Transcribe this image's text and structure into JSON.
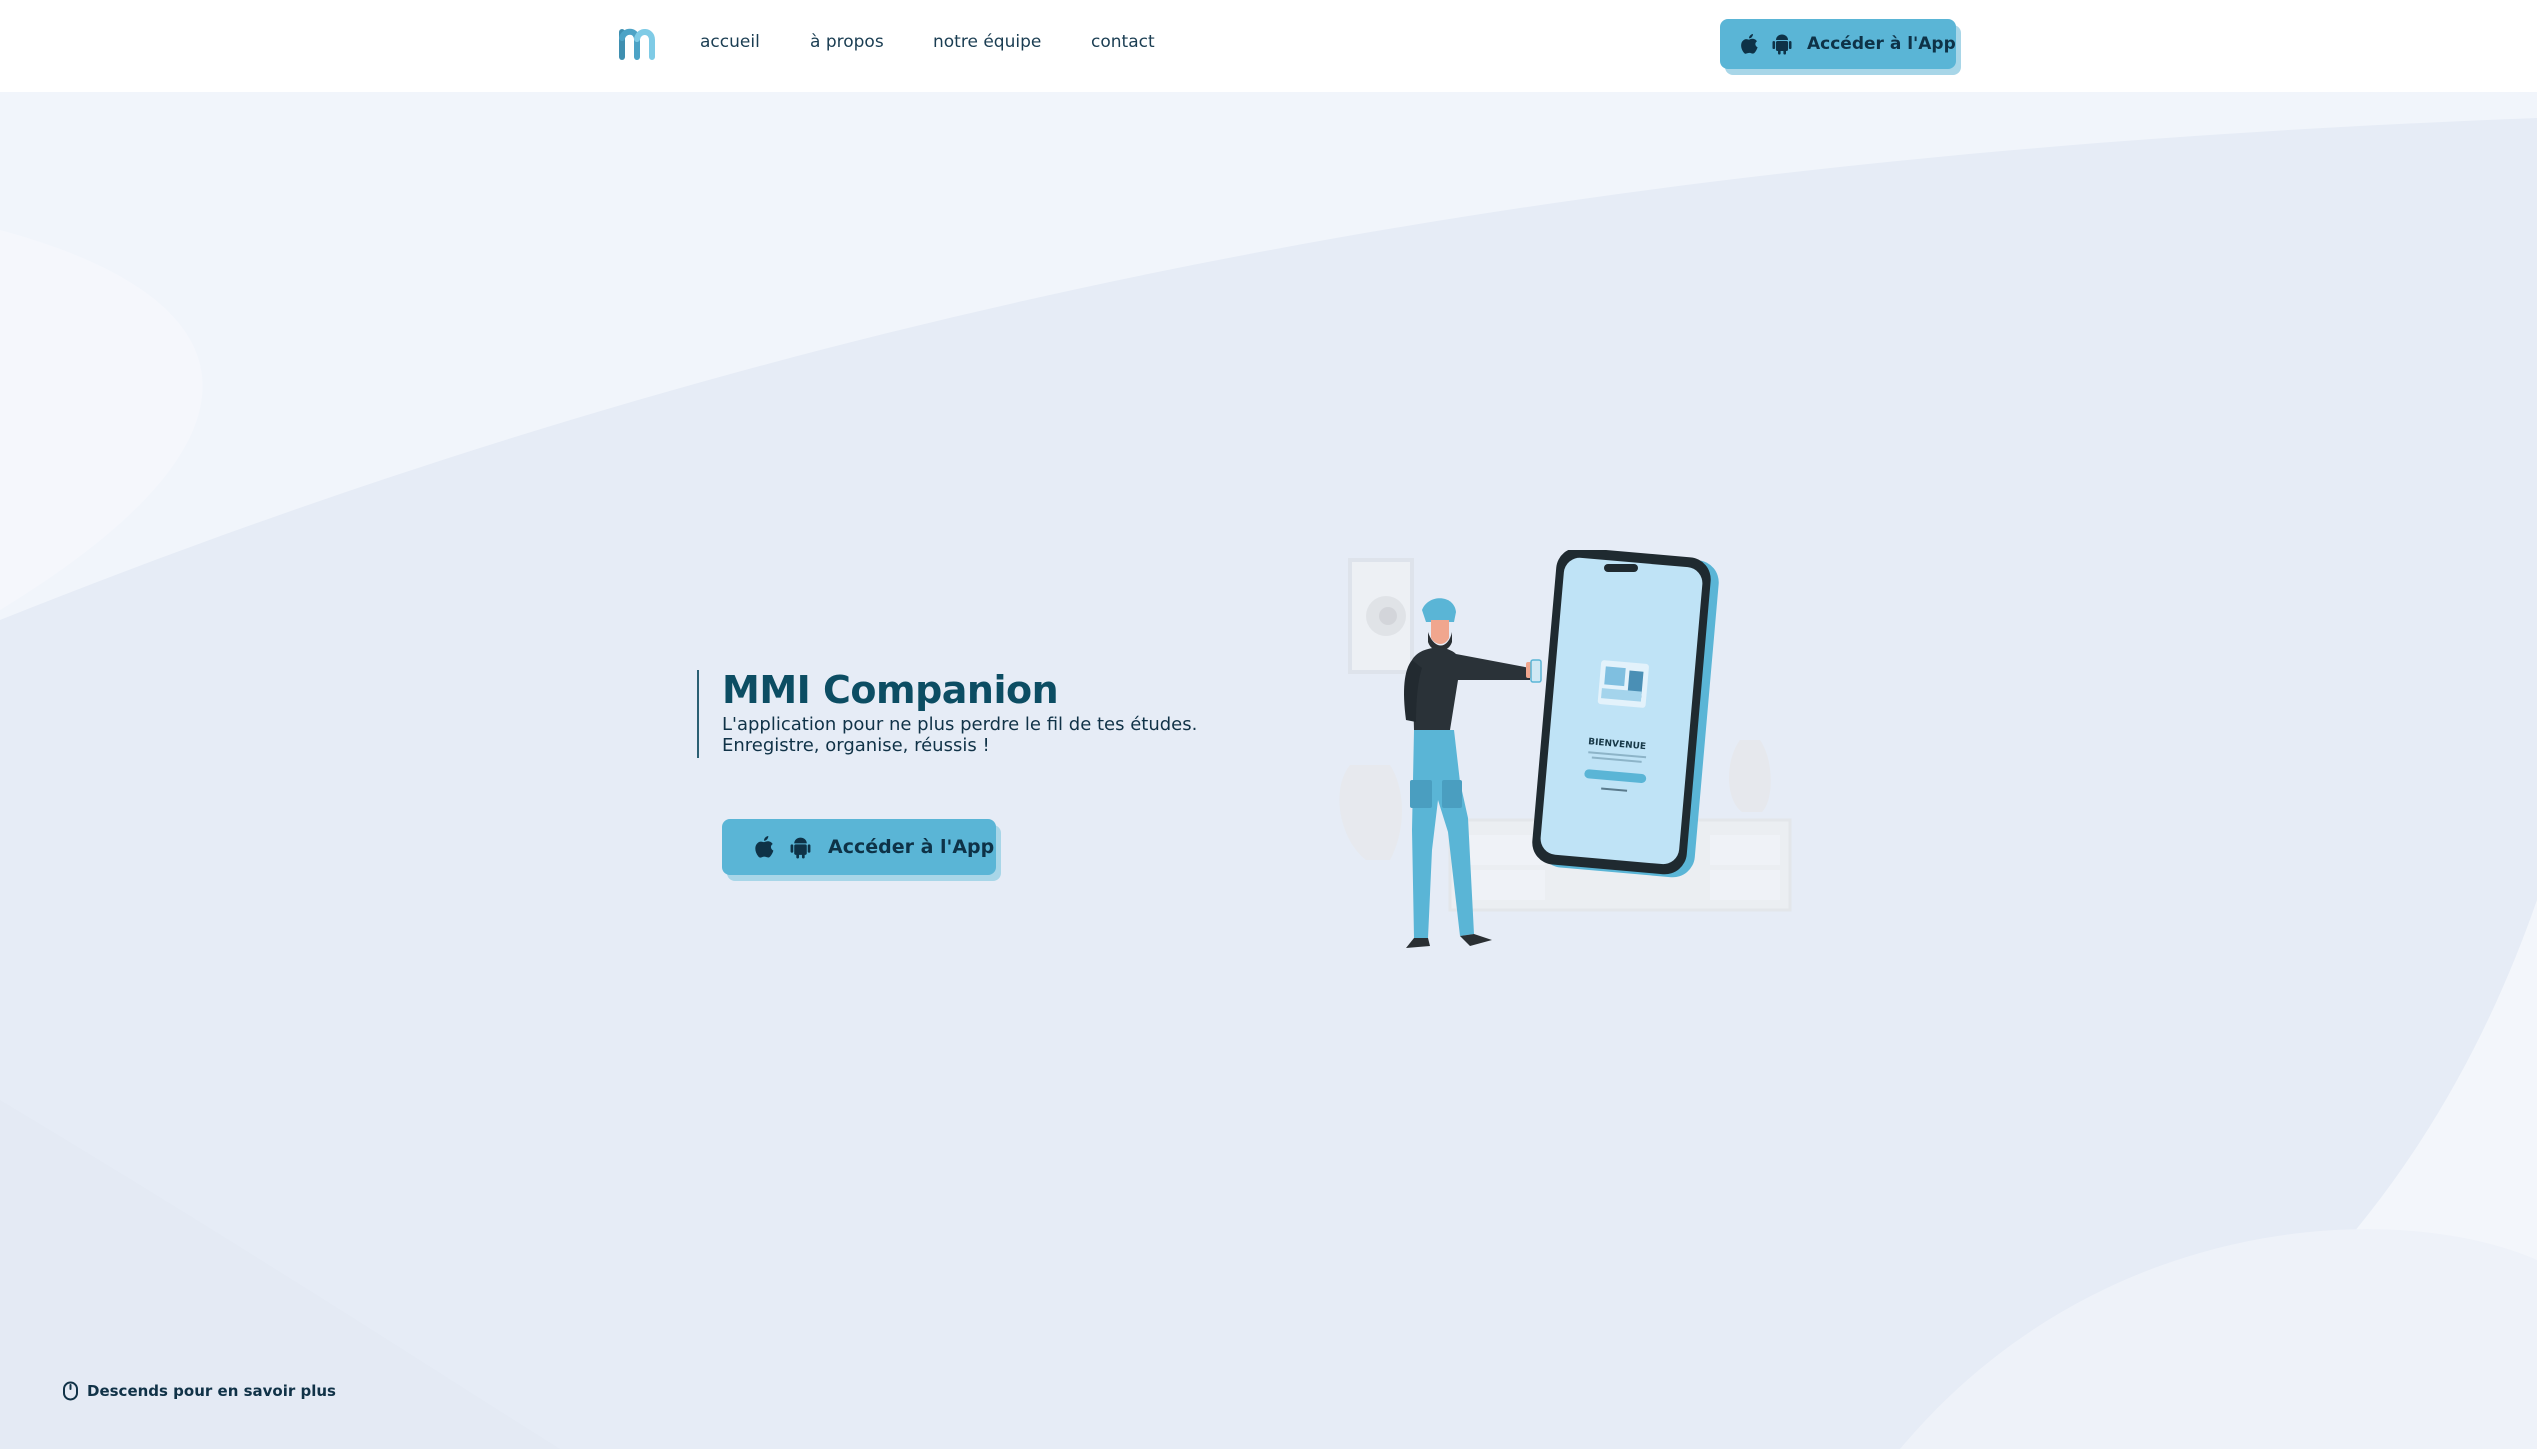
{
  "nav": {
    "logo_icon": "mmi-m-logo-icon",
    "links": [
      "accueil",
      "à propos",
      "notre équipe",
      "contact"
    ],
    "cta_label": "Accéder à l'App"
  },
  "hero": {
    "title": "MMI Companion",
    "subtitle_line1": "L'application pour ne plus perdre le fil de tes études.",
    "subtitle_line2": "Enregistre, organise, réussis !",
    "cta_label": "Accéder à l'App"
  },
  "illustration": {
    "phone_title": "BIENVENUE"
  },
  "footer": {
    "scroll_hint": "Descends pour en savoir plus"
  },
  "icons": [
    "apple-icon",
    "android-icon",
    "mouse-icon"
  ],
  "colors": {
    "accent": "#5ab5d6",
    "title": "#0c4d63",
    "text": "#103247",
    "background": "#e6ecf6"
  }
}
